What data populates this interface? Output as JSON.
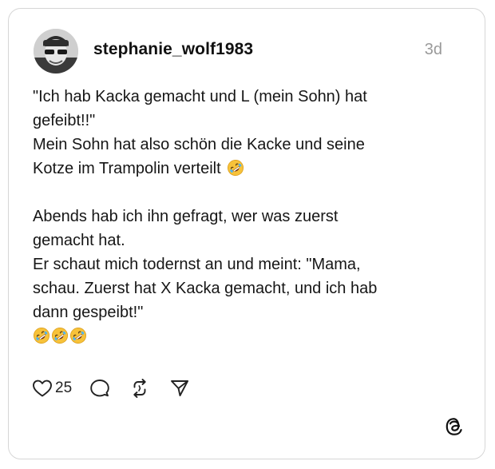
{
  "post": {
    "username": "stephanie_wolf1983",
    "time_ago": "3d",
    "text_lines": [
      "\"Ich hab Kacka gemacht und L (mein Sohn) hat",
      "gefeibt!!\"",
      "Mein Sohn hat also schön die Kacke und seine",
      "Kotze im Trampolin verteilt",
      "Abends hab ich ihn gefragt, wer was zuerst",
      "gemacht hat.",
      "Er schaut mich todernst an und meint: \"Mama,",
      "schau. Zuerst hat X Kacka gemacht, und ich hab",
      "dann gespeibt!\""
    ],
    "emoji": "rolling-on-floor-laughing"
  },
  "actions": {
    "like_count": "25",
    "icons": [
      "heart-icon",
      "comment-icon",
      "repost-icon",
      "share-icon"
    ]
  },
  "brand": {
    "logo": "threads-logo-icon"
  },
  "colors": {
    "text": "#161616",
    "muted": "#9a9a9a",
    "border": "#d6d6d6",
    "emoji_face": "#f7c23a"
  }
}
